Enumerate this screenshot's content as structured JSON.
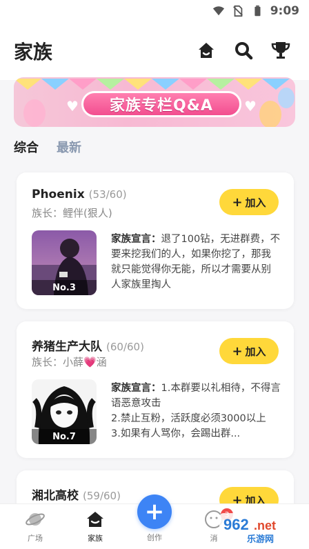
{
  "status_bar": {
    "time": "9:09",
    "icons": [
      "wifi-icon",
      "sim-off-icon",
      "battery-icon"
    ]
  },
  "header": {
    "title": "家族",
    "icons": [
      "home-icon",
      "search-icon",
      "trophy-icon"
    ]
  },
  "banner": {
    "title": "家族专栏Q&A"
  },
  "tabs": [
    {
      "label": "综合",
      "active": true
    },
    {
      "label": "最新",
      "active": false
    }
  ],
  "families": [
    {
      "name": "Phoenix",
      "count": "(53/60)",
      "leader": "族长：鲤伴(狠人)",
      "join_label": "加入",
      "rank": "No.3",
      "decl_label": "家族宣言：",
      "decl_text": "退了100钻，无进群费，不要来挖我们的人，如果你挖了，那我就只能觉得你无能，所以才需要从别人家族里掏人"
    },
    {
      "name": "养猪生产大队",
      "count": "(60/60)",
      "leader": "族长：小薛💗涵",
      "join_label": "加入",
      "rank": "No.7",
      "decl_label": "家族宣言：",
      "decl_text": "1.本群要以礼相待，不得言语恶意攻击\n2.禁止互粉，活跃度必须3000以上\n3.如果有人骂你，会踢出群..."
    },
    {
      "name": "湘北高校",
      "count": "(59/60)",
      "join_label": "加入"
    }
  ],
  "bottom_nav": [
    {
      "label": "广场",
      "icon": "planet-icon"
    },
    {
      "label": "家族",
      "icon": "family-house-icon",
      "active": true
    },
    {
      "label": "创作",
      "icon": "plus-icon"
    },
    {
      "label": "消",
      "icon": "message-face-icon",
      "badge": "3"
    }
  ],
  "watermark": {
    "text": "962.net",
    "sub": "乐游网"
  },
  "colors": {
    "accent_yellow": "#ffd83a",
    "create_blue": "#3d84f5",
    "badge_red": "#f04a4a"
  }
}
